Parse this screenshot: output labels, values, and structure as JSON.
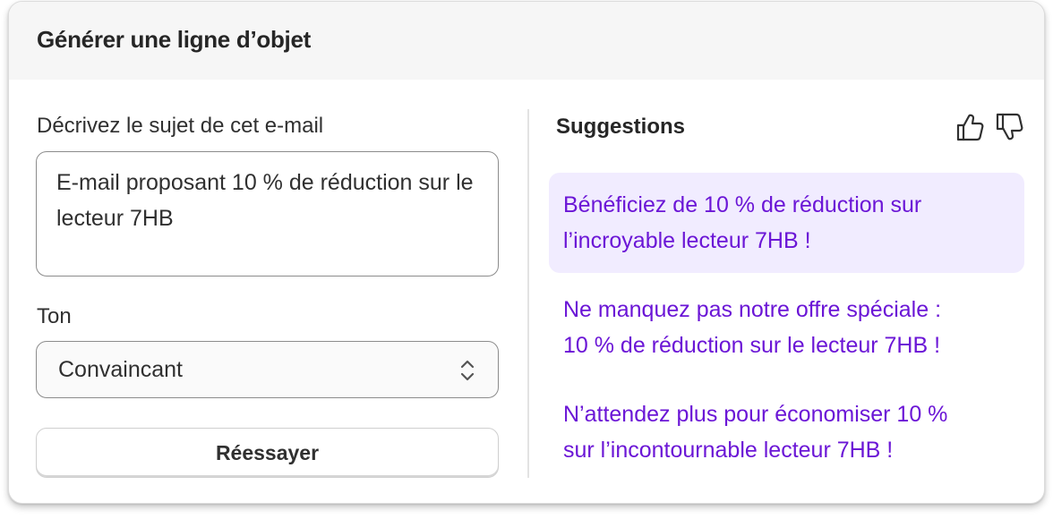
{
  "header": {
    "title": "Générer une ligne d’objet"
  },
  "form": {
    "subject_label": "Décrivez le sujet de cet e-mail",
    "subject_value": "E-mail proposant 10 % de réduction sur le lecteur 7HB",
    "tone_label": "Ton",
    "tone_value": "Convaincant",
    "retry_label": "Réessayer"
  },
  "suggestions": {
    "title": "Suggestions",
    "items": [
      {
        "line1": "Bénéficiez de 10 % de réduction sur",
        "line2": "l’incroyable lecteur 7HB !",
        "selected": true
      },
      {
        "line1": "Ne manquez pas notre offre spéciale :",
        "line2": "10 % de réduction sur le lecteur 7HB !",
        "selected": false
      },
      {
        "line1": "N’attendez plus pour économiser 10 %",
        "line2": "sur l’incontournable lecteur 7HB !",
        "selected": false
      }
    ],
    "feedback_icons": [
      "thumbs-up-icon",
      "thumbs-down-icon"
    ]
  },
  "colors": {
    "suggestion_text": "#6b16d6",
    "suggestion_selected_bg": "#f1ecff",
    "header_bg": "#f6f6f6"
  }
}
